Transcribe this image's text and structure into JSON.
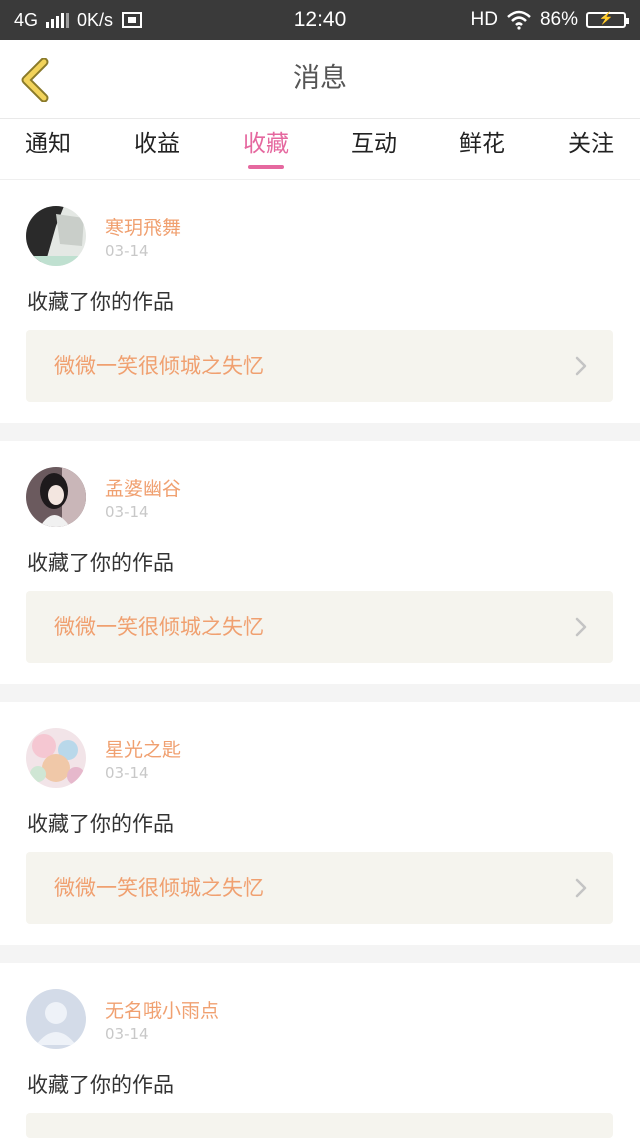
{
  "status_bar": {
    "network": "4G",
    "speed": "0K/s",
    "time": "12:40",
    "hd": "HD",
    "battery": "86%",
    "icons": [
      "signal-icon",
      "screenshot-icon",
      "wifi-icon",
      "battery-icon"
    ]
  },
  "header": {
    "title": "消息",
    "back_icon": "back-chevron-icon",
    "accent_color": "#e8c24a"
  },
  "tabs": [
    {
      "label": "通知",
      "active": false
    },
    {
      "label": "收益",
      "active": false
    },
    {
      "label": "收藏",
      "active": true
    },
    {
      "label": "互动",
      "active": false
    },
    {
      "label": "鲜花",
      "active": false
    },
    {
      "label": "关注",
      "active": false
    }
  ],
  "colors": {
    "active_tab": "#e5689f",
    "username": "#f0a070",
    "work_title": "#f0a070",
    "work_box_bg": "#f5f4ee"
  },
  "notifications": [
    {
      "username": "寒玥飛舞",
      "date": "03-14",
      "action": "收藏了你的作品",
      "work_title": "微微一笑很倾城之失忆",
      "avatar_icon": "user-avatar"
    },
    {
      "username": "孟婆幽谷",
      "date": "03-14",
      "action": "收藏了你的作品",
      "work_title": "微微一笑很倾城之失忆",
      "avatar_icon": "user-avatar"
    },
    {
      "username": "星光之匙",
      "date": "03-14",
      "action": "收藏了你的作品",
      "work_title": "微微一笑很倾城之失忆",
      "avatar_icon": "user-avatar"
    },
    {
      "username": "无名哦小雨点",
      "date": "03-14",
      "action": "收藏了你的作品",
      "work_title": "",
      "avatar_icon": "default-avatar-icon"
    }
  ]
}
